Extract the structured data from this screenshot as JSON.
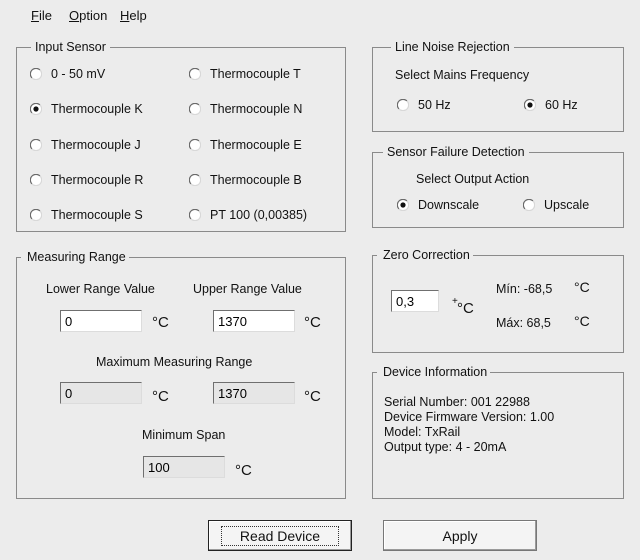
{
  "menu": {
    "file": {
      "accel": "F",
      "rest": "ile"
    },
    "option": {
      "accel": "O",
      "rest": "ption"
    },
    "help": {
      "accel": "H",
      "rest": "elp"
    }
  },
  "input_sensor": {
    "title": "Input Sensor",
    "options": [
      {
        "label": "0 - 50 mV",
        "selected": false
      },
      {
        "label": "Thermocouple T",
        "selected": false
      },
      {
        "label": "Thermocouple K",
        "selected": true
      },
      {
        "label": "Thermocouple N",
        "selected": false
      },
      {
        "label": "Thermocouple J",
        "selected": false
      },
      {
        "label": "Thermocouple E",
        "selected": false
      },
      {
        "label": "Thermocouple R",
        "selected": false
      },
      {
        "label": "Thermocouple B",
        "selected": false
      },
      {
        "label": "Thermocouple S",
        "selected": false
      },
      {
        "label": "PT 100 (0,00385)",
        "selected": false
      }
    ]
  },
  "line_noise": {
    "title": "Line Noise Rejection",
    "subtitle": "Select Mains Frequency",
    "options": [
      {
        "label": "50 Hz",
        "selected": false
      },
      {
        "label": "60 Hz",
        "selected": true
      }
    ]
  },
  "sensor_failure": {
    "title": "Sensor Failure Detection",
    "subtitle": "Select Output Action",
    "options": [
      {
        "label": "Downscale",
        "selected": true
      },
      {
        "label": "Upscale",
        "selected": false
      }
    ]
  },
  "measuring_range": {
    "title": "Measuring Range",
    "lower_label": "Lower Range Value",
    "upper_label": "Upper Range Value",
    "lower_value": "0",
    "upper_value": "1370",
    "max_label": "Maximum Measuring Range",
    "max_lower": "0",
    "max_upper": "1370",
    "min_span_label": "Minimum Span",
    "min_span": "100",
    "unit": "°C"
  },
  "zero_correction": {
    "title": "Zero Correction",
    "value": "0,3",
    "unit_sup": "+",
    "unit": "°C",
    "min_label": "Mín: -68,5",
    "max_label": "Máx: 68,5",
    "min_unit": "°C",
    "max_unit": "°C"
  },
  "device_info": {
    "title": "Device Information",
    "serial": "Serial Number: 001 22988",
    "firmware": "Device Firmware Version: 1.00",
    "model": "Model: TxRail",
    "output": "Output type: 4 - 20mA"
  },
  "buttons": {
    "read": "Read Device",
    "apply": "Apply"
  }
}
